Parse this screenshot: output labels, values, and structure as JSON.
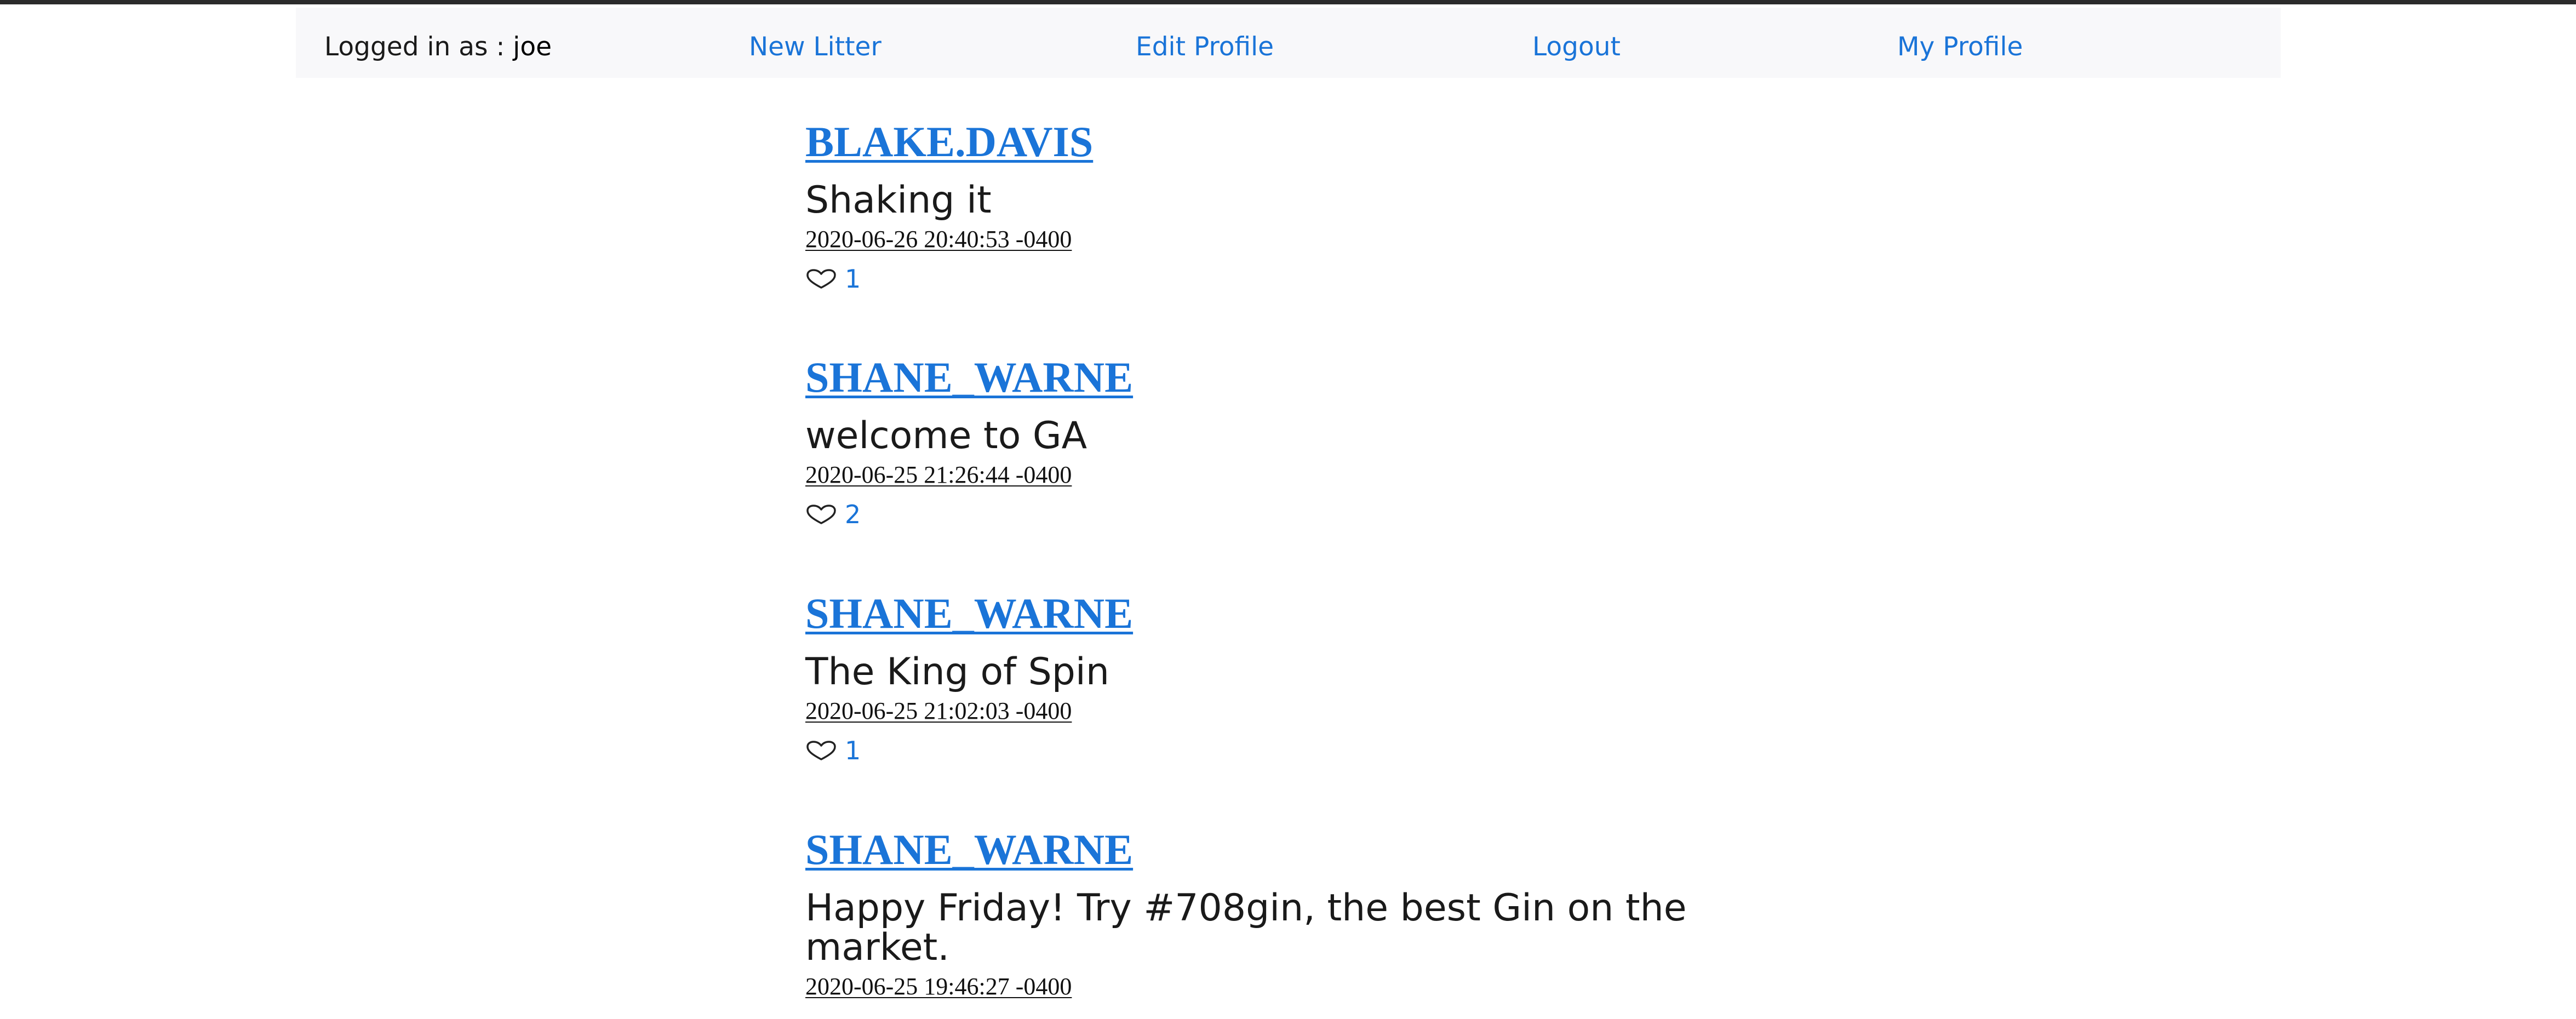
{
  "nav": {
    "logged_in_label": "Logged in as : ",
    "username": "joe",
    "new_litter": "New Litter",
    "edit_profile": "Edit Profile",
    "logout": "Logout",
    "my_profile": "My Profile"
  },
  "posts": [
    {
      "author": "BLAKE.DAVIS",
      "text": "Shaking it",
      "timestamp": "2020-06-26 20:40:53 -0400",
      "likes": "1"
    },
    {
      "author": "SHANE_WARNE",
      "text": "welcome to GA",
      "timestamp": "2020-06-25 21:26:44 -0400",
      "likes": "2"
    },
    {
      "author": "SHANE_WARNE",
      "text": "The King of Spin",
      "timestamp": "2020-06-25 21:02:03 -0400",
      "likes": "1"
    },
    {
      "author": "SHANE_WARNE",
      "text": "Happy Friday! Try #708gin, the best Gin on the market.",
      "timestamp": "2020-06-25 19:46:27 -0400",
      "likes": ""
    }
  ],
  "colors": {
    "link": "#1a74d8",
    "navbar_bg": "#f8f8fa",
    "text": "#1a1a1a"
  },
  "icons": {
    "like": "heart-icon"
  }
}
